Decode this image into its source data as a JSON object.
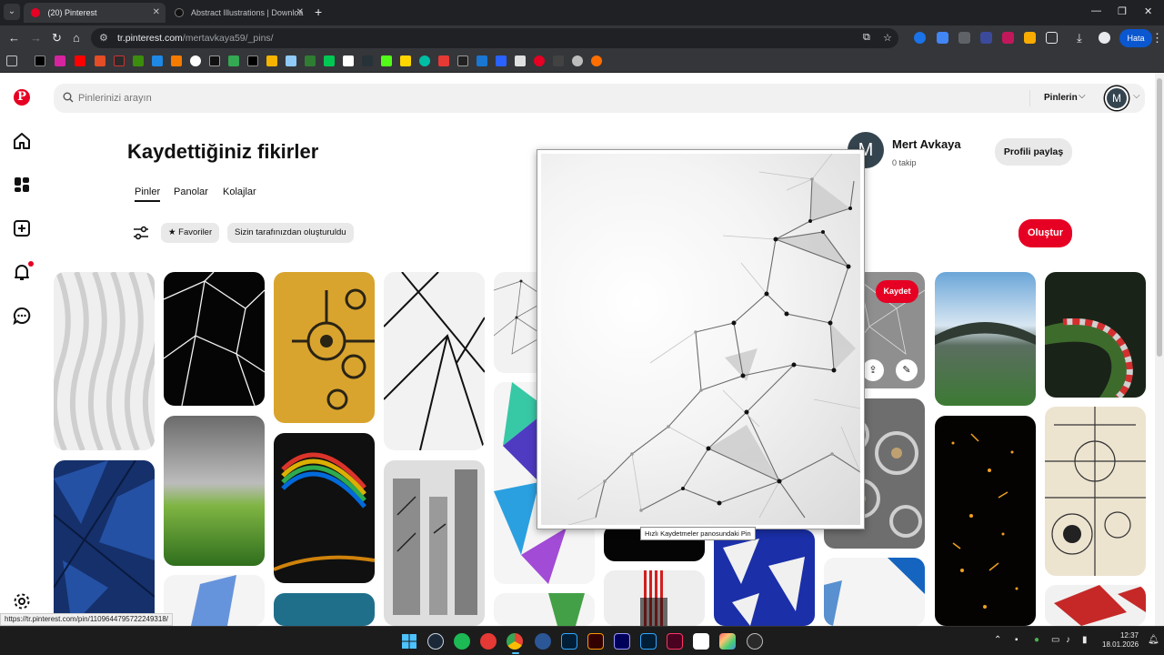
{
  "browser": {
    "tabs": [
      {
        "label": "(20) Pinterest",
        "active": true
      },
      {
        "label": "Abstract Illustrations | Downloa",
        "active": false
      }
    ],
    "url_host": "tr.pinterest.com",
    "url_path": "/mertavkaya59/_pins/",
    "error_badge": "Hata"
  },
  "search": {
    "placeholder": "Pinlerinizi arayın",
    "filter_label": "Pinlerin"
  },
  "user": {
    "initial": "M"
  },
  "page": {
    "title": "Kaydettiğiniz fikirler",
    "tabs": [
      "Pinler",
      "Panolar",
      "Kolajlar"
    ],
    "selected_tab": "Pinler",
    "chips": [
      "Favoriler",
      "Sizin tarafınızdan oluşturuldu"
    ],
    "create_label": "Oluştur"
  },
  "profile": {
    "initial": "M",
    "name": "Mert Avkaya",
    "followers": "0 takip",
    "share_label": "Profili paylaş"
  },
  "pin_actions": {
    "save_label": "Kaydet"
  },
  "preview": {
    "caption": "Hızlı Kaydetmeler panosundaki Pin"
  },
  "status_url": "https://tr.pinterest.com/pin/1109644795722249318/",
  "clock": {
    "time": "12:37",
    "date": "18.01.2026"
  },
  "colors": {
    "brand": "#e60023",
    "chrome_dark": "#202124",
    "chrome": "#35363a"
  }
}
